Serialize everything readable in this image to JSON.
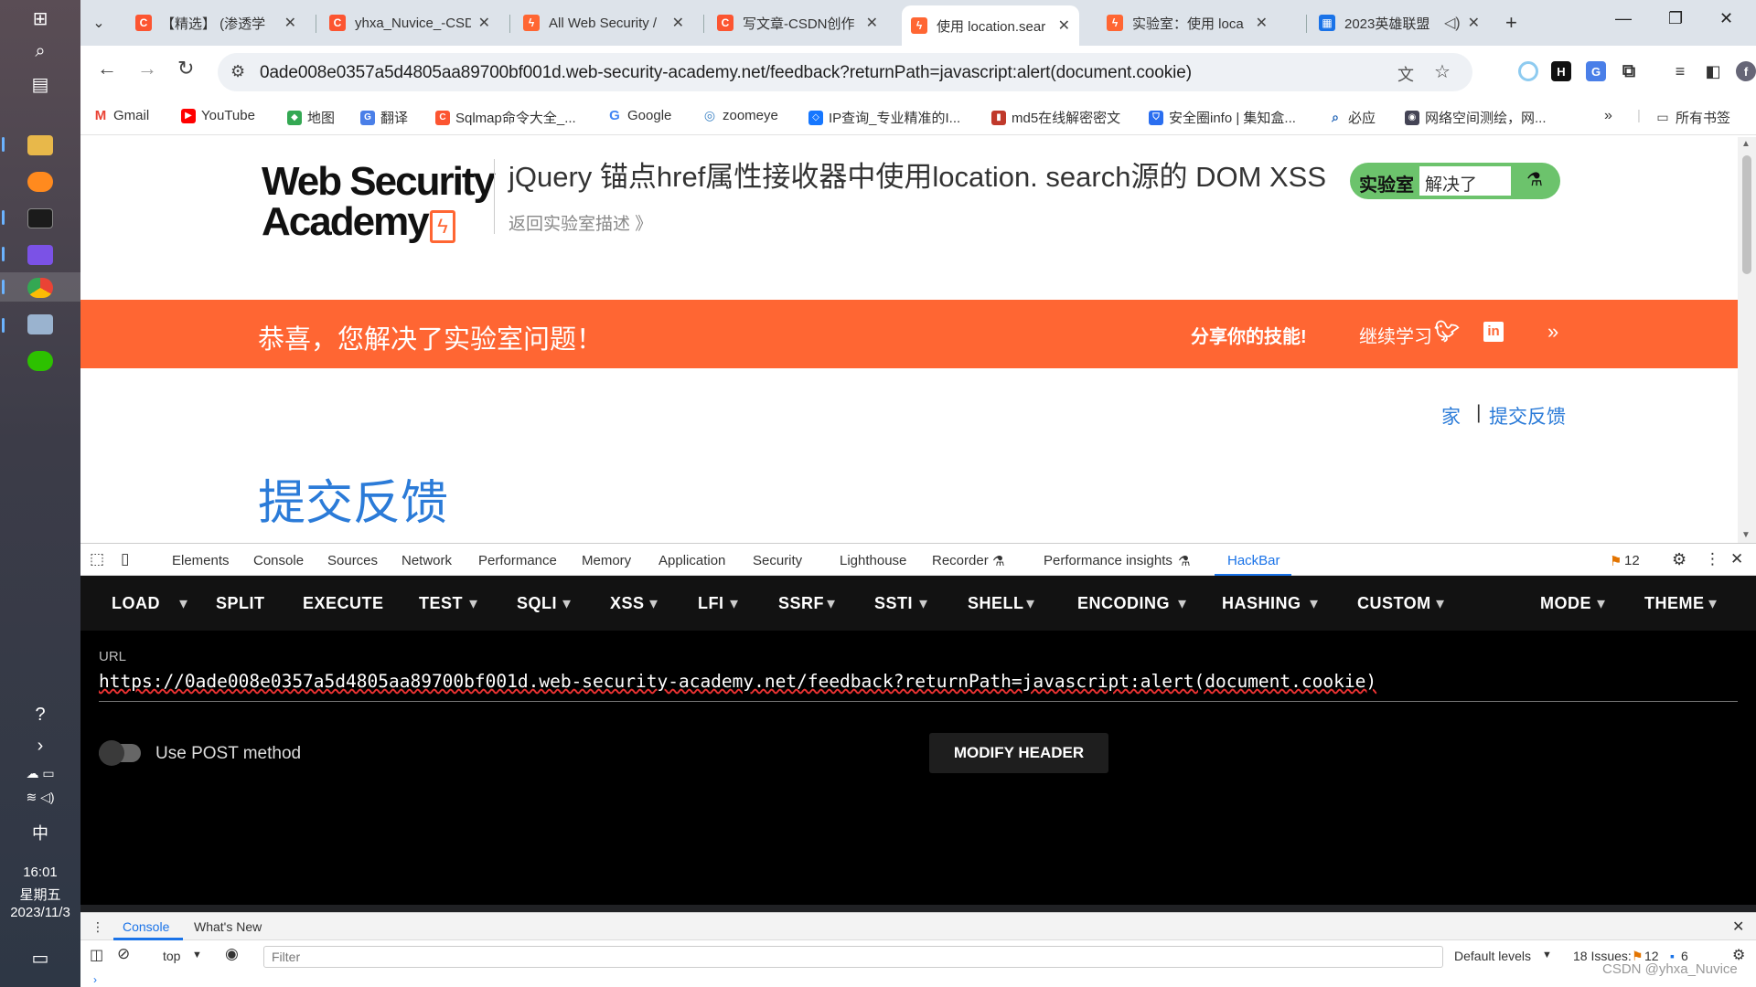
{
  "taskbar": {
    "ime": "中",
    "time": "16:01",
    "weekday": "星期五",
    "date": "2023/11/3"
  },
  "tabs": [
    {
      "title": "【精选】 (渗透学"
    },
    {
      "title": "yhxa_Nuvice_-CSD"
    },
    {
      "title": "All Web Security /"
    },
    {
      "title": "写文章-CSDN创作"
    },
    {
      "title": "使用 location.sear"
    },
    {
      "title": "实验室：使用 loca"
    },
    {
      "title": "2023英雄联盟"
    }
  ],
  "omnibox": {
    "url": "0ade008e0357a5d4805aa89700bf001d.web-security-academy.net/feedback?returnPath=javascript:alert(document.cookie)"
  },
  "bookmarks": [
    "Gmail",
    "YouTube",
    "地图",
    "翻译",
    "Sqlmap命令大全_...",
    "Google",
    "zoomeye",
    "IP查询_专业精准的I...",
    "md5在线解密密文",
    "安全圈info | 集知盒...",
    "必应",
    "网络空间测绘，网..."
  ],
  "bookmarks_all": "所有书签",
  "lab": {
    "logo_line1": "Web Security",
    "logo_line2": "Academy",
    "title": "jQuery 锚点href属性接收器中使用location. search源的 DOM XSS",
    "back": "返回实验室描述 》",
    "badge_label": "实验室",
    "badge_status": "解决了"
  },
  "banner": {
    "congrats": "恭喜，您解决了实验室问题！",
    "share": "分享你的技能!",
    "continue": "继续学习"
  },
  "nav": {
    "home": "家",
    "sep": "|",
    "feedback": "提交反馈"
  },
  "page_heading": "提交反馈",
  "devtools": {
    "tabs": [
      "Elements",
      "Console",
      "Sources",
      "Network",
      "Performance",
      "Memory",
      "Application",
      "Security",
      "Lighthouse",
      "Recorder",
      "Performance insights",
      "HackBar"
    ],
    "issues_count": "12"
  },
  "hackbar": {
    "menu": [
      "LOAD",
      "SPLIT",
      "EXECUTE",
      "TEST",
      "SQLI",
      "XSS",
      "LFI",
      "SSRF",
      "SSTI",
      "SHELL",
      "ENCODING",
      "HASHING",
      "CUSTOM",
      "MODE",
      "THEME"
    ],
    "url_label": "URL",
    "url_value": "https://0ade008e0357a5d4805aa89700bf001d.web-security-academy.net/feedback?returnPath=javascript:alert(document.cookie)",
    "post_label": "Use POST method",
    "modify_header": "MODIFY HEADER"
  },
  "drawer": {
    "tabs": [
      "Console",
      "What's New"
    ],
    "context": "top",
    "filter_placeholder": "Filter",
    "levels": "Default levels",
    "issues": "18 Issues:",
    "warn_count": "12",
    "info_count": "6"
  },
  "watermark": "CSDN @yhxa_Nuvice"
}
